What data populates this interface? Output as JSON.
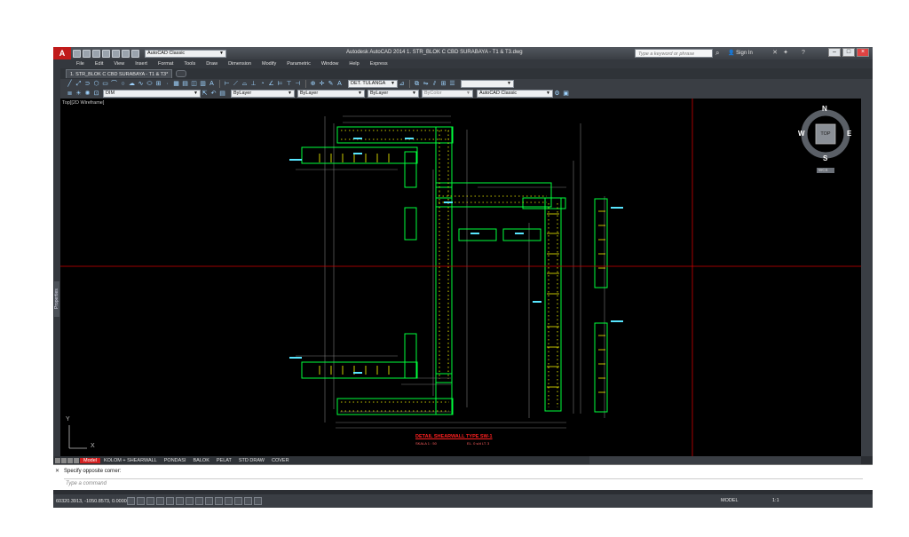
{
  "app": {
    "title": "Autodesk AutoCAD 2014   1. STR_BLOK C CBD SURABAYA - T1 & T3.dwg",
    "logo": "A",
    "workspace": "AutoCAD Classic",
    "search_placeholder": "Type a keyword or phrase",
    "signin_label": "Sign In"
  },
  "menu": [
    "File",
    "Edit",
    "View",
    "Insert",
    "Format",
    "Tools",
    "Draw",
    "Dimension",
    "Modify",
    "Parametric",
    "Window",
    "Help",
    "Express"
  ],
  "doc_tab": "1. STR_BLOK C CBD SURABAYA - T1 & T3*",
  "toolbar": {
    "dimstyle": "DET. TULANGA",
    "layer": "DIM",
    "color": "ByLayer",
    "linetype": "ByLayer",
    "lineweight": "ByLayer",
    "plotstyle": "ByColor",
    "workspace2": "AutoCAD Classic"
  },
  "viewport": {
    "label": "Top][2D Wireframe]",
    "viewcube": {
      "n": "N",
      "s": "S",
      "e": "E",
      "w": "W",
      "center": "TOP",
      "wcs": "WCS"
    },
    "ucs_x": "X",
    "ucs_y": "Y",
    "drawing_title": "DETAIL SHEARWALL TYPE SW-1",
    "drawing_subtitle_left": "SKALA 1 : 50",
    "drawing_subtitle_right": "EL. 0 s/d LT. 3"
  },
  "properties_tab": "Properties",
  "layout_tabs": [
    {
      "label": "Model",
      "active": true
    },
    {
      "label": "KOLOM + SHEARWALL",
      "active": false
    },
    {
      "label": "PONDASI",
      "active": false
    },
    {
      "label": "BALOK",
      "active": false
    },
    {
      "label": "PELAT",
      "active": false
    },
    {
      "label": "STD DRAW",
      "active": false
    },
    {
      "label": "COVER",
      "active": false
    }
  ],
  "command": {
    "history": "Specify opposite corner:",
    "placeholder": "Type a command"
  },
  "status": {
    "coords": "60320.3913, -1050.8573, 0.0000",
    "model": "MODEL",
    "scale": "1:1"
  },
  "colors": {
    "canvas": "#000000",
    "wall": "#00ff3c",
    "rebar": "#ffff00",
    "dim": "#7a7a7a",
    "crosshair": "#d00000",
    "title_text": "#ff2020"
  }
}
